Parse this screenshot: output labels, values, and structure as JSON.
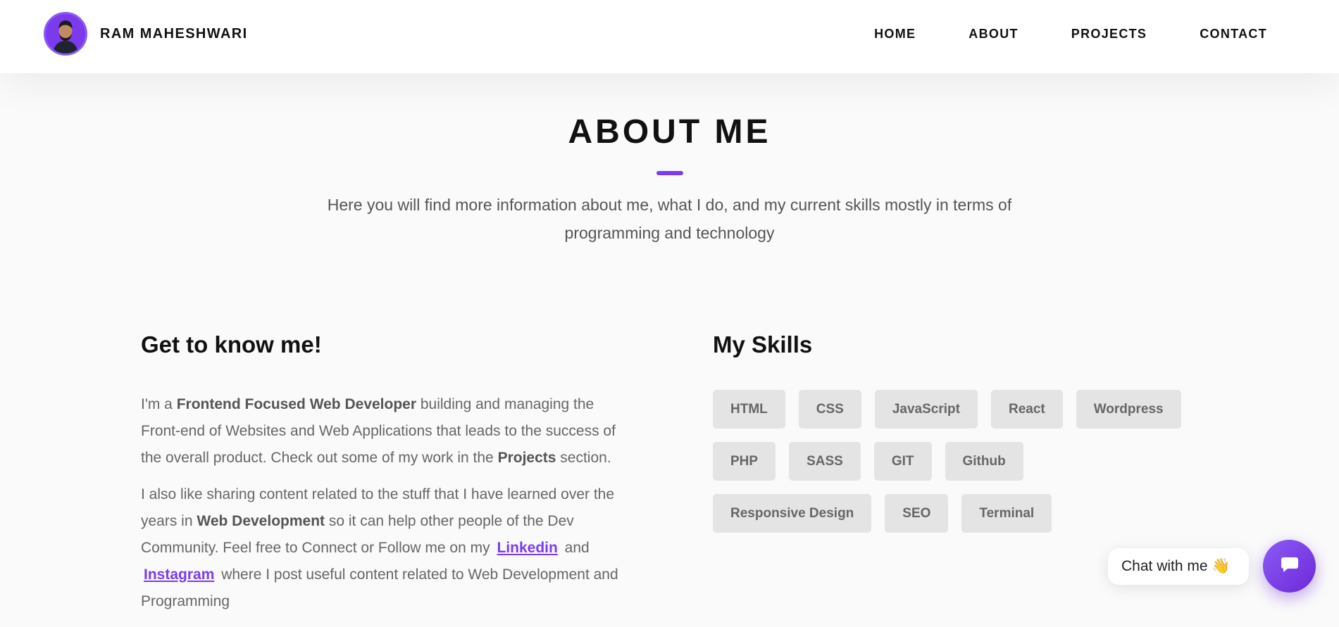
{
  "brand": {
    "name": "RAM MAHESHWARI"
  },
  "nav": {
    "home": "HOME",
    "about": "ABOUT",
    "projects": "PROJECTS",
    "contact": "CONTACT"
  },
  "about": {
    "title": "ABOUT ME",
    "subtitle": "Here you will find more information about me, what I do, and my current skills mostly in terms of programming and technology"
  },
  "intro": {
    "title": "Get to know me!",
    "p1": {
      "a": "I'm a ",
      "b": "Frontend Focused Web Developer",
      "c": " building and managing the Front-end of Websites and Web Applications that leads to the success of the overall product. Check out some of my work in the ",
      "d": "Projects",
      "e": " section."
    },
    "p2": {
      "a": "I also like sharing content related to the stuff that I have learned over the years in ",
      "b": "Web Development",
      "c": " so it can help other people of the Dev Community. Feel free to Connect or Follow me on my ",
      "linkedin": "Linkedin",
      "d": " and ",
      "instagram": "Instagram",
      "e": " where I post useful content related to Web Development and Programming"
    }
  },
  "skills": {
    "title": "My Skills",
    "items": [
      "HTML",
      "CSS",
      "JavaScript",
      "React",
      "Wordpress",
      "PHP",
      "SASS",
      "GIT",
      "Github",
      "Responsive Design",
      "SEO",
      "Terminal"
    ]
  },
  "chat": {
    "label": "Chat with me 👋",
    "icon": "chat-icon"
  },
  "colors": {
    "accent": "#7c3aed",
    "tag_bg": "#e4e4e4",
    "page_bg": "#fafafa"
  }
}
